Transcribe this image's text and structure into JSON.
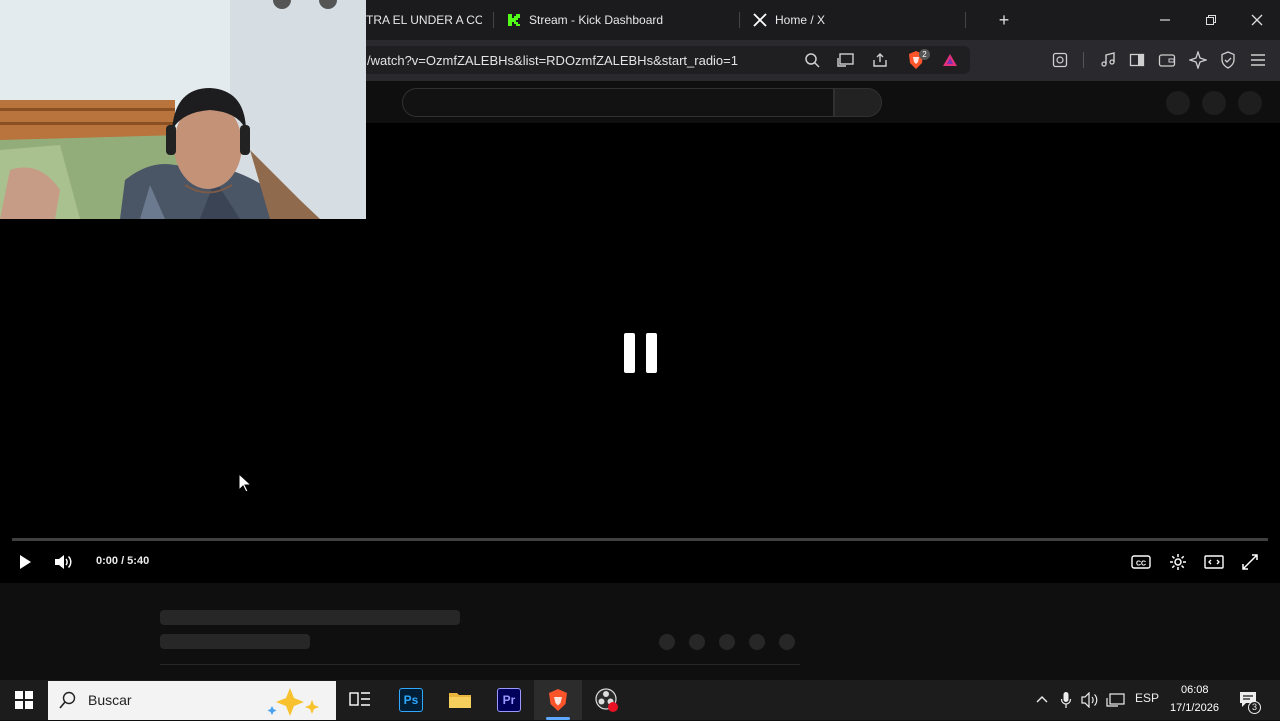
{
  "browser": {
    "tabs": [
      {
        "label": "TRA EL UNDER A COS",
        "icon": "youtube-icon"
      },
      {
        "label": "Stream - Kick Dashboard",
        "icon": "kick-icon"
      },
      {
        "label": "Home / X",
        "icon": "x-icon"
      }
    ],
    "new_tab": "+",
    "url": "/watch?v=OzmfZALEBHs&list=RDOzmfZALEBHs&start_radio=1",
    "brave_shield_count": "2"
  },
  "player": {
    "state": "paused",
    "time": "0:00 / 5:40",
    "progress": 0
  },
  "taskbar": {
    "search_placeholder": "Buscar",
    "apps": [
      {
        "name": "task-view",
        "label": ""
      },
      {
        "name": "photoshop",
        "label": "Ps"
      },
      {
        "name": "file-explorer",
        "label": ""
      },
      {
        "name": "premiere",
        "label": "Pr"
      },
      {
        "name": "brave",
        "label": ""
      },
      {
        "name": "obs",
        "label": ""
      }
    ],
    "language": "ESP",
    "clock_time": "06:08",
    "clock_date": "17/1/2026",
    "notification_count": "3"
  },
  "colors": {
    "kick_green": "#53fc18",
    "brave_orange": "#fb542b",
    "ps_blue": "#31a8ff",
    "pr_purple": "#9999ff"
  }
}
